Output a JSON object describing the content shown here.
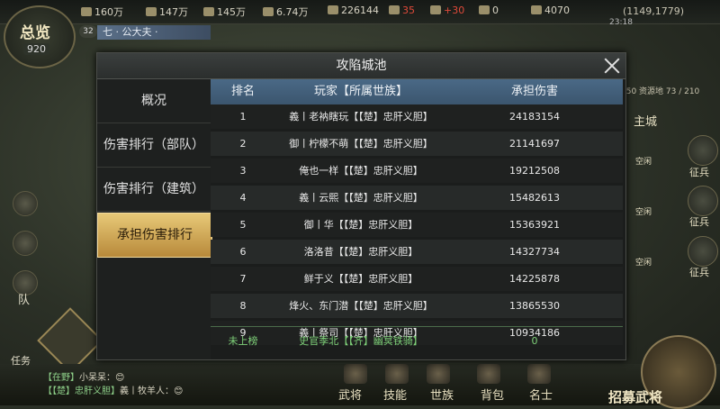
{
  "hud": {
    "resources": [
      {
        "icon": "wood-icon",
        "value": "160万"
      },
      {
        "icon": "iron-icon",
        "value": "147万"
      },
      {
        "icon": "stone-icon",
        "value": "145万"
      },
      {
        "icon": "grain-icon",
        "value": "6.74万"
      },
      {
        "icon": "copper-icon",
        "value": "226144"
      },
      {
        "icon": "jade-icon",
        "value": "35",
        "red": true
      },
      {
        "icon": "gold-icon",
        "value": "+30",
        "red": true
      },
      {
        "icon": "token-icon",
        "value": "0"
      },
      {
        "icon": "coin-icon",
        "value": "4070"
      }
    ],
    "coords": "(1149,1779)",
    "clock": "23:18",
    "overview_label": "总览",
    "overview_count": "920",
    "level": "32",
    "title": "七 · 公大夫 ·",
    "resource_limit": "150  资源地 73 / 210",
    "main_city": "主城",
    "idle": "空闲",
    "recruit_troops": "征兵",
    "team": "队",
    "task": "任务",
    "bottom_nav": [
      "武将",
      "技能",
      "世族",
      "背包",
      "名士"
    ],
    "recruit_label": "招募武将",
    "chat": [
      {
        "channel": "【在野】",
        "text": "小呆呆：😊"
      },
      {
        "channel": "【【楚】忠肝义胆】",
        "text": "義丨牧羊人：😊"
      }
    ]
  },
  "modal": {
    "title": "攻陷城池",
    "tabs": [
      "概况",
      "伤害排行（部队）",
      "伤害排行（建筑）",
      "承担伤害排行"
    ],
    "active_tab": 3,
    "columns": [
      "排名",
      "玩家【所属世族】",
      "承担伤害"
    ],
    "rows": [
      {
        "rank": "1",
        "player": "義丨老衲瞎玩【【楚】忠肝义胆】",
        "damage": "24183154"
      },
      {
        "rank": "2",
        "player": "御丨柠檬不萌【【楚】忠肝义胆】",
        "damage": "21141697"
      },
      {
        "rank": "3",
        "player": "俺也一样【【楚】忠肝义胆】",
        "damage": "19212508"
      },
      {
        "rank": "4",
        "player": "義丨云熙【【楚】忠肝义胆】",
        "damage": "15482613"
      },
      {
        "rank": "5",
        "player": "御丨华【【楚】忠肝义胆】",
        "damage": "15363921"
      },
      {
        "rank": "6",
        "player": "洛洛昔【【楚】忠肝义胆】",
        "damage": "14327734"
      },
      {
        "rank": "7",
        "player": "鲜于义【【楚】忠肝义胆】",
        "damage": "14225878"
      },
      {
        "rank": "8",
        "player": "烽火、东门潜【【楚】忠肝义胆】",
        "damage": "13865530"
      },
      {
        "rank": "9",
        "player": "義丨祭司【【楚】忠肝义胆】",
        "damage": "10934186"
      }
    ],
    "self": {
      "rank": "未上榜",
      "player": "史官季北【【齐】幽冥铁骑】",
      "damage": "0"
    }
  }
}
